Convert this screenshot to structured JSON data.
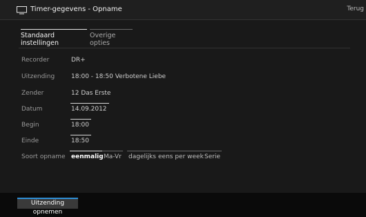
{
  "window": {
    "title": "Timer-gegevens - Opname",
    "back_label": "Terug",
    "icon": "tv-icon"
  },
  "tabs": [
    {
      "label": "Standaard instellingen",
      "active": true
    },
    {
      "label": "Overige opties",
      "active": false
    }
  ],
  "fields": {
    "recorder": {
      "label": "Recorder",
      "value": "DR+"
    },
    "uitzending": {
      "label": "Uitzending",
      "value": "18:00 - 18:50 Verbotene Liebe"
    },
    "zender": {
      "label": "Zender",
      "value": "12 Das Erste"
    },
    "datum": {
      "label": "Datum",
      "value": "14.09.2012"
    },
    "begin": {
      "label": "Begin",
      "value": "18:00"
    },
    "einde": {
      "label": "Einde",
      "value": "18:50"
    }
  },
  "recording_type": {
    "label": "Soort opname",
    "options": [
      "eenmalig",
      "Ma-Vr",
      "dagelijks",
      "eens per week",
      "Serie"
    ],
    "selected": "eenmalig"
  },
  "footer": {
    "button_label": "Uitzending opnemen",
    "accent_color": "#2e8fd8"
  }
}
